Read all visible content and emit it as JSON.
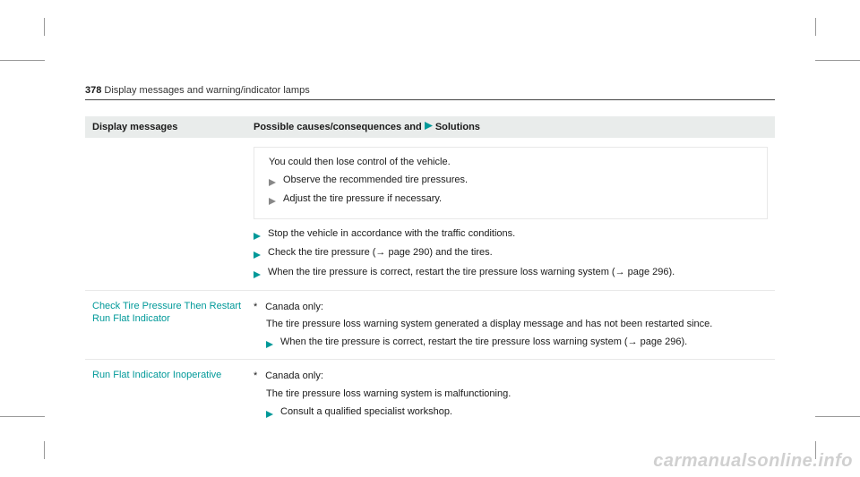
{
  "page_number": "378",
  "section_title": "Display messages and warning/indicator lamps",
  "table": {
    "header_col1": "Display messages",
    "header_col2_prefix": "Possible causes/consequences and ",
    "header_col2_suffix": "Solutions"
  },
  "row1": {
    "inset_line1": "You could then lose control of the vehicle.",
    "inset_action1": "Observe the recommended tire pressures.",
    "inset_action2": "Adjust the tire pressure if necessary.",
    "action1": "Stop the vehicle in accordance with the traffic conditions.",
    "action2": "Check the tire pressure (→ page 290) and the tires.",
    "action3": "When the tire pressure is correct, restart the tire pressure loss warning system (→ page 296)."
  },
  "row2": {
    "message": "Check Tire Pressure Then Restart Run Flat Indicator",
    "line1": "Canada only:",
    "line2": "The tire pressure loss warning system generated a display message and has not been restarted since.",
    "action1": "When the tire pressure is correct, restart the tire pressure loss warning system (→ page 296)."
  },
  "row3": {
    "message": "Run Flat Indicator Inoperative",
    "line1": "Canada only:",
    "line2": "The tire pressure loss warning system is malfunctioning.",
    "action1": "Consult a qualified specialist workshop."
  },
  "watermark": "carmanualsonline.info"
}
